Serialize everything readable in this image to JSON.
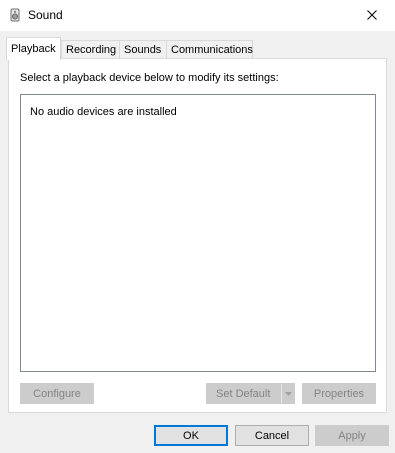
{
  "window": {
    "title": "Sound",
    "title_icon": "speaker-icon",
    "close_icon": "close-icon"
  },
  "tabs": [
    {
      "label": "Playback",
      "active": true
    },
    {
      "label": "Recording",
      "active": false
    },
    {
      "label": "Sounds",
      "active": false
    },
    {
      "label": "Communications",
      "active": false
    }
  ],
  "playback": {
    "instruction": "Select a playback device below to modify its settings:",
    "empty_message": "No audio devices are installed",
    "configure_label": "Configure",
    "set_default_label": "Set Default",
    "properties_label": "Properties"
  },
  "footer": {
    "ok_label": "OK",
    "cancel_label": "Cancel",
    "apply_label": "Apply"
  },
  "colors": {
    "accent": "#0078d7",
    "disabled_text": "#838383",
    "dialog_bg": "#f0f0f0"
  }
}
